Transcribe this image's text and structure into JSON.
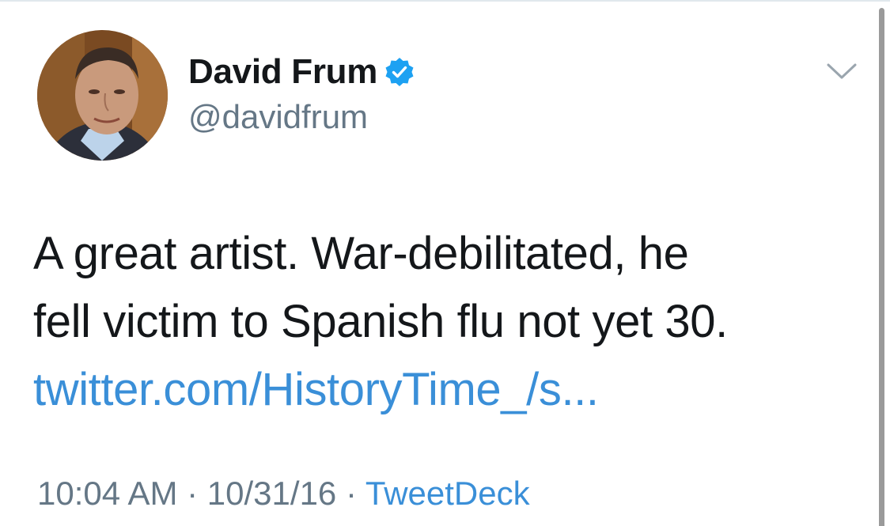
{
  "author": {
    "display_name": "David Frum",
    "handle": "@davidfrum",
    "verified": true,
    "verified_icon": "verified-badge-icon"
  },
  "menu": {
    "icon": "chevron-down-icon"
  },
  "tweet": {
    "text_line_1": "A great artist. War-debilitated, he",
    "text_line_2": "fell victim to Spanish flu not yet 30.",
    "link_text": "twitter.com/HistoryTime_/s..."
  },
  "meta": {
    "time": "10:04 AM",
    "separator": " · ",
    "date": "10/31/16",
    "source": "TweetDeck"
  },
  "colors": {
    "link": "#3a8fd8",
    "verified": "#1da1f2",
    "secondary_text": "#657786",
    "primary_text": "#14171a"
  }
}
